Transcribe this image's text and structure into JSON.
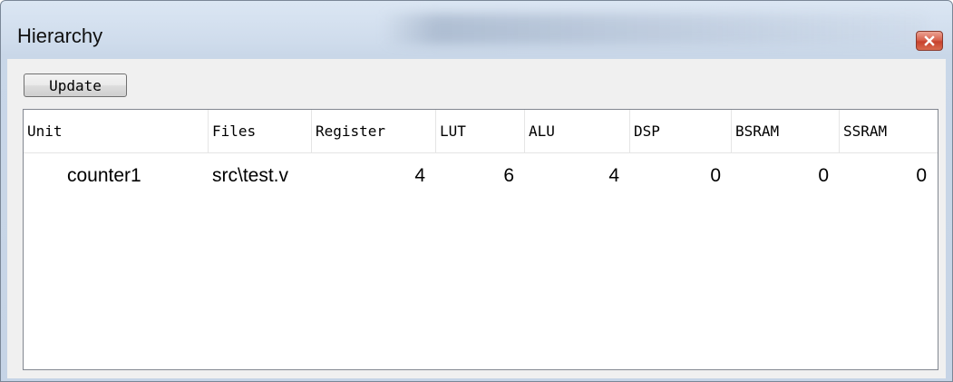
{
  "window": {
    "title": "Hierarchy"
  },
  "toolbar": {
    "update_label": "Update"
  },
  "table": {
    "columns": [
      "Unit",
      "Files",
      "Register",
      "LUT",
      "ALU",
      "DSP",
      "BSRAM",
      "SSRAM"
    ],
    "rows": [
      {
        "unit": "counter1",
        "files": "src\\test.v",
        "register": "4",
        "lut": "6",
        "alu": "4",
        "dsp": "0",
        "bsram": "0",
        "ssram": "0"
      }
    ]
  },
  "colors": {
    "close_button": "#d0533c",
    "frame": "#c6d4e6",
    "client_bg": "#f0f0f0"
  },
  "icons": {
    "close": "close-icon"
  }
}
